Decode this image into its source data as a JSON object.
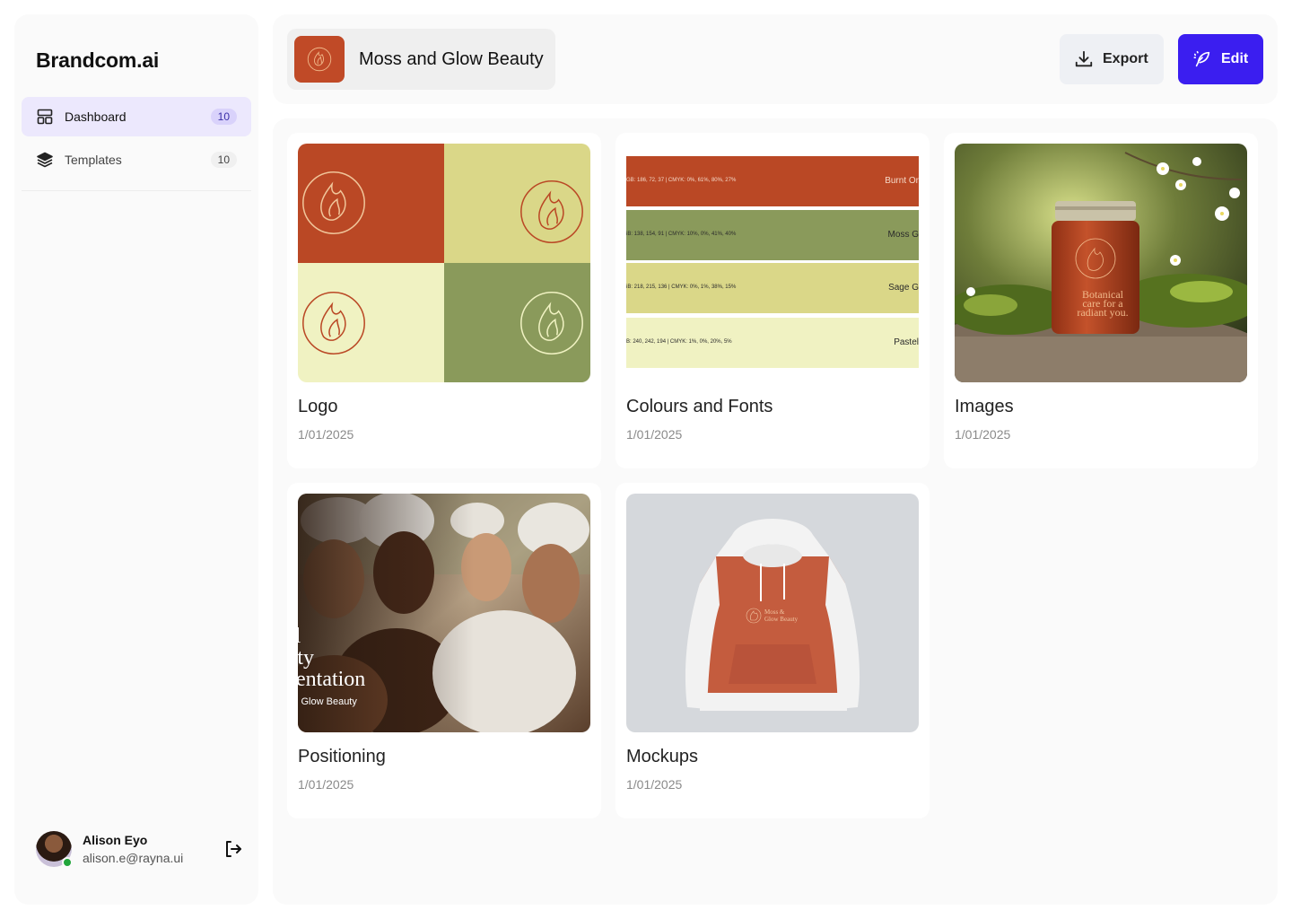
{
  "brand": {
    "name": "Brandcom.ai"
  },
  "sidebar": {
    "items": [
      {
        "label": "Dashboard",
        "count": "10",
        "icon": "layout-icon",
        "active": true
      },
      {
        "label": "Templates",
        "count": "10",
        "icon": "layers-icon",
        "active": false
      }
    ]
  },
  "user": {
    "name": "Alison Eyo",
    "email": "alison.e@rayna.ui",
    "status": "online"
  },
  "header": {
    "project_name": "Moss and Glow Beauty",
    "export_label": "Export",
    "edit_label": "Edit"
  },
  "colors": {
    "accent": "#3b1ef0",
    "burnt_orange": "#ba4825",
    "moss": "#8a9a5b",
    "sage": "#dad788",
    "pastel": "#f0f2c2"
  },
  "cards": [
    {
      "title": "Logo",
      "date": "1/01/2025"
    },
    {
      "title": "Colours and Fonts",
      "date": "1/01/2025"
    },
    {
      "title": "Images",
      "date": "1/01/2025"
    },
    {
      "title": "Positioning",
      "date": "1/01/2025"
    },
    {
      "title": "Mockups",
      "date": "1/01/2025"
    }
  ],
  "palette": [
    {
      "code": "GB: 186, 72, 37 | CMYK: 0%, 61%, 80%, 27%",
      "name": "Burnt Or"
    },
    {
      "code": "iB: 138, 154, 91 | CMYK: 10%, 0%, 41%, 40%",
      "name": "Moss G"
    },
    {
      "code": "iB: 218, 215, 136 | CMYK: 0%, 1%, 38%, 15%",
      "name": "Sage G"
    },
    {
      "code": "B: 240, 242, 194 | CMYK: 1%, 0%, 20%, 5%",
      "name": "Pastel"
    }
  ],
  "jar_text": {
    "line1": "Botanical",
    "line2": "care for a",
    "line3": "radiant you."
  },
  "positioning_text": {
    "line1": "al",
    "line2": "tity",
    "line3": "entation",
    "line4": "l Glow Beauty"
  },
  "hoodie_text": {
    "line1": "Moss &",
    "line2": "Glow Beauty"
  }
}
